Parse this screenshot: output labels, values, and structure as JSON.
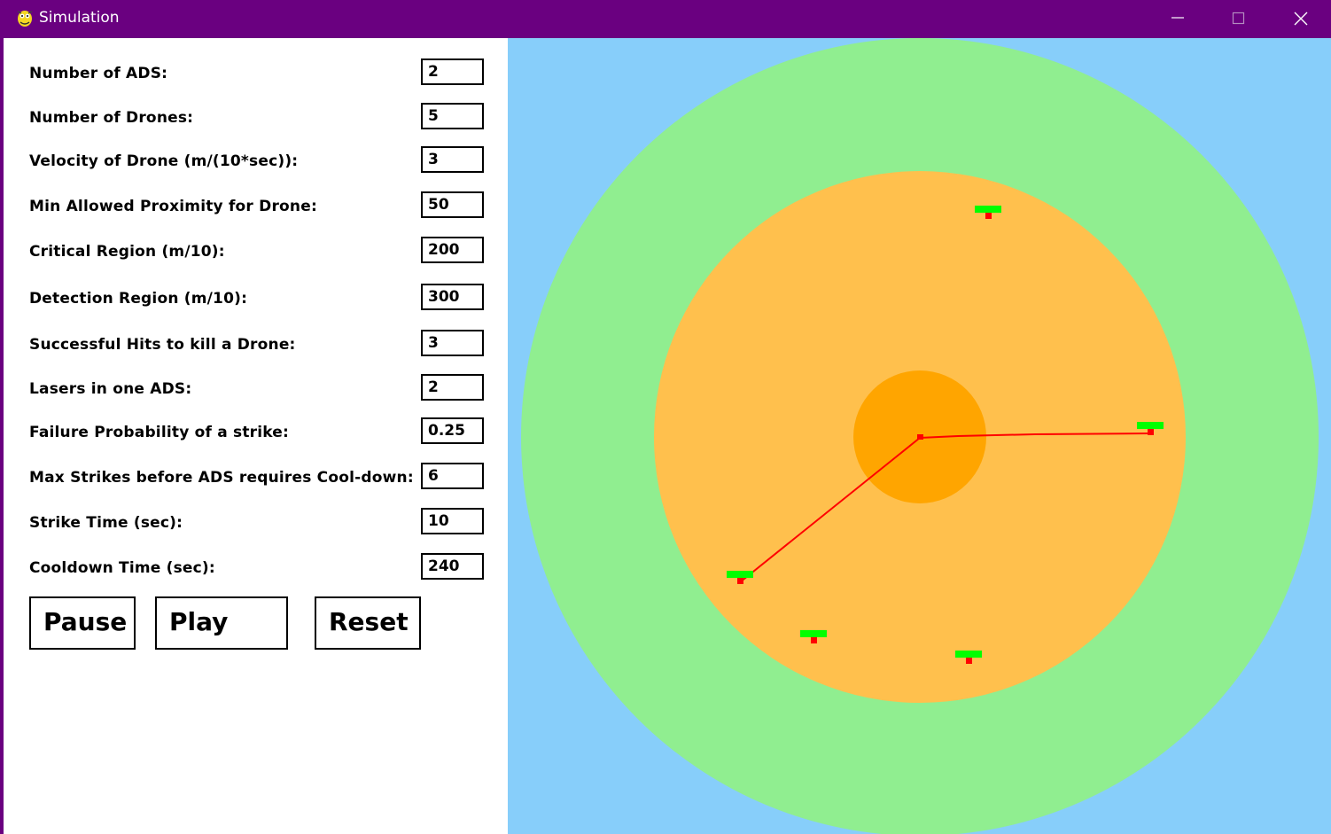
{
  "window": {
    "title": "Simulation"
  },
  "fields": [
    {
      "label": "Number of ADS:",
      "value": "2"
    },
    {
      "label": "Number of Drones:",
      "value": "5"
    },
    {
      "label": "Velocity of Drone (m/(10*sec)):",
      "value": "3"
    },
    {
      "label": "Min Allowed Proximity for Drone:",
      "value": "50"
    },
    {
      "label": "Critical Region (m/10):",
      "value": "200"
    },
    {
      "label": "Detection Region (m/10):",
      "value": "300"
    },
    {
      "label": "Successful Hits to kill a Drone:",
      "value": "3"
    },
    {
      "label": "Lasers in one ADS:",
      "value": "2"
    },
    {
      "label": "Failure Probability of a strike:",
      "value": "0.25"
    },
    {
      "label": "Max Strikes before ADS requires Cool-down:",
      "value": "6"
    },
    {
      "label": "Strike Time (sec):",
      "value": "10"
    },
    {
      "label": "Cooldown Time (sec):",
      "value": "240"
    }
  ],
  "buttons": {
    "pause": "Pause",
    "play": "Play",
    "reset": "Reset"
  },
  "colors": {
    "titlebar": "#6a0080",
    "sky": "#87cefa",
    "detection_region": "#90ee90",
    "critical_region": "#ffc04d",
    "ads_zone": "#ffa500",
    "laser": "#ff0000",
    "drone_health": "#00ff00",
    "drone_body": "#ff0000"
  }
}
